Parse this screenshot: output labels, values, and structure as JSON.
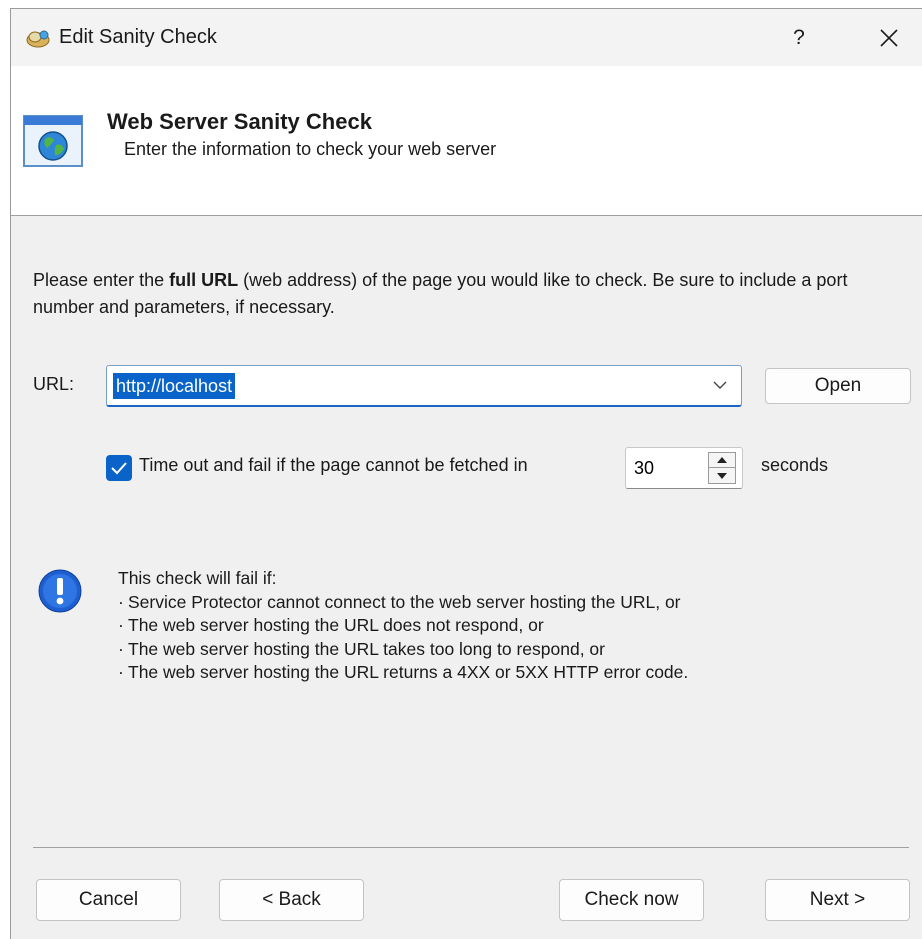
{
  "window": {
    "title": "Edit Sanity Check",
    "help_label": "?",
    "close_icon": "close-icon"
  },
  "header": {
    "title": "Web Server Sanity Check",
    "subtitle": "Enter the information to check your web server",
    "icon": "web-page-globe-icon"
  },
  "intro": {
    "prefix": "Please enter the ",
    "bold": "full URL",
    "suffix": " (web address) of the page you would like to check. Be sure to include a port number and parameters, if necessary."
  },
  "url": {
    "label": "URL:",
    "value": "http://localhost",
    "open_label": "Open"
  },
  "timeout": {
    "checked": true,
    "label": "Time out and fail if the page cannot be fetched in",
    "value": "30",
    "unit_label": "seconds"
  },
  "info": {
    "icon": "exclamation-info-icon",
    "heading": "This check will fail if:",
    "bullet": "·",
    "items": [
      "Service Protector cannot connect to the web server hosting the URL, or",
      "The web server hosting the URL does not respond, or",
      "The web server hosting the URL takes too long to respond, or",
      "The web server hosting the URL returns a 4XX or 5XX HTTP error code."
    ]
  },
  "footer": {
    "cancel_label": "Cancel",
    "back_label": "< Back",
    "check_label": "Check now",
    "next_label": "Next >"
  },
  "colors": {
    "accent": "#0a63c9",
    "dialog_bg": "#f0f0f0",
    "header_bg": "#ffffff"
  }
}
